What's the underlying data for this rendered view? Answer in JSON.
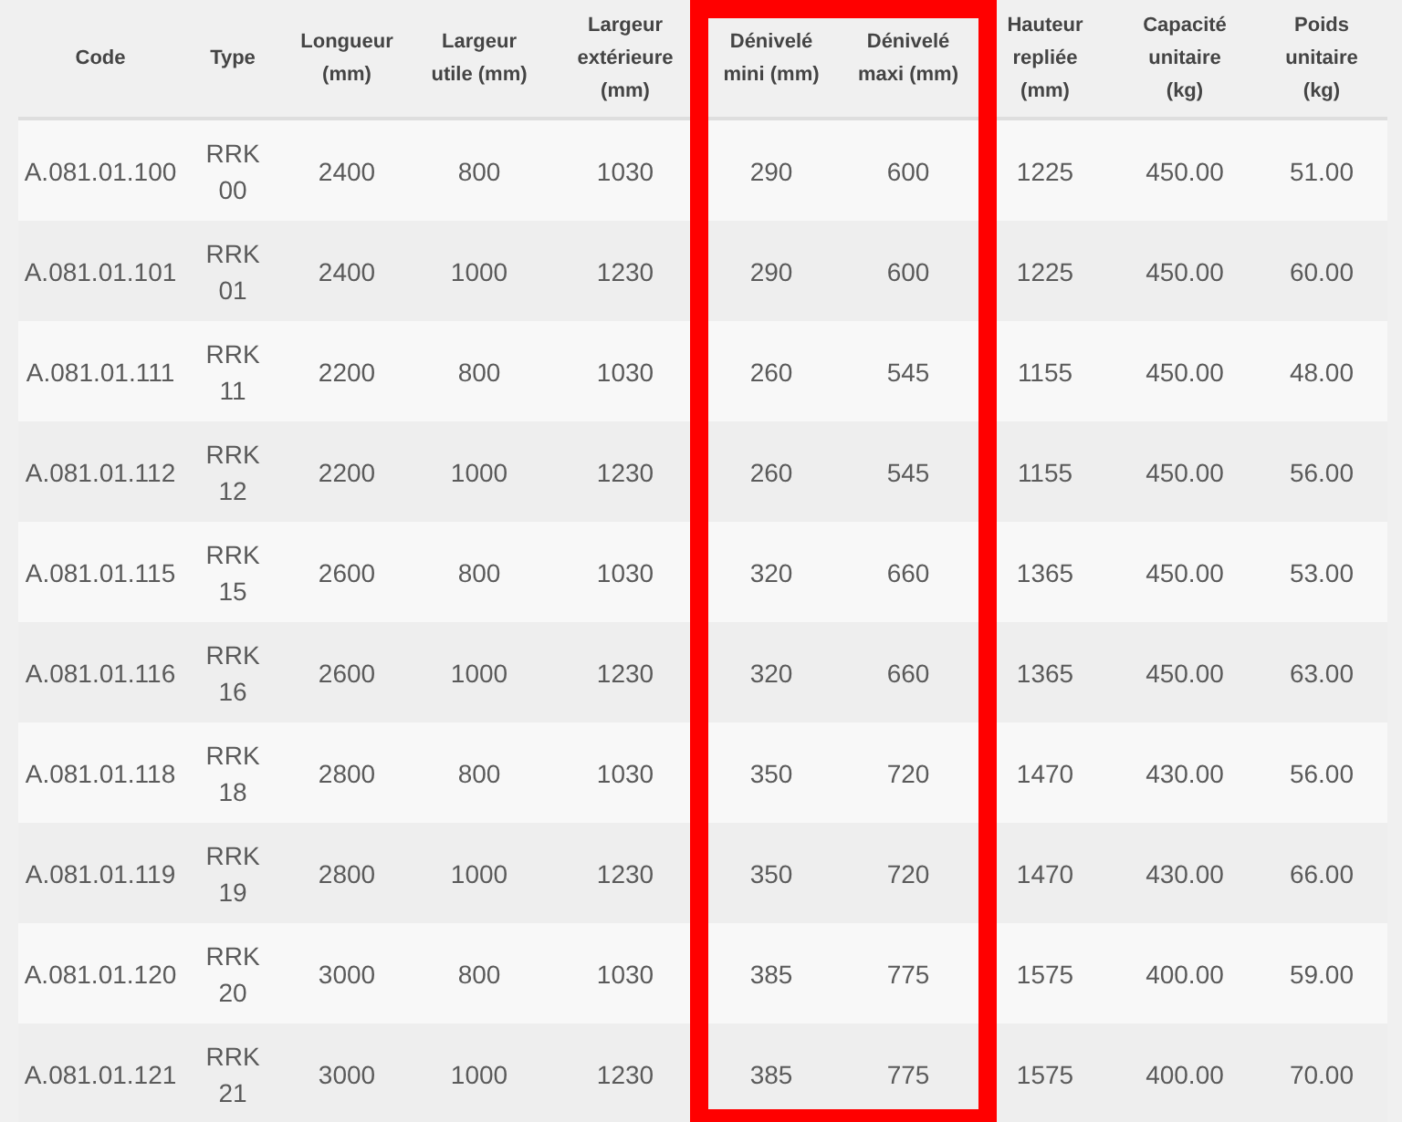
{
  "table": {
    "columns": [
      {
        "label": "Code",
        "highlighted": false
      },
      {
        "label": "Type",
        "highlighted": false
      },
      {
        "label": "Longueur (mm)",
        "highlighted": false
      },
      {
        "label": "Largeur utile (mm)",
        "highlighted": false
      },
      {
        "label": "Largeur extérieure (mm)",
        "highlighted": false
      },
      {
        "label": "Dénivelé mini (mm)",
        "highlighted": true
      },
      {
        "label": "Dénivelé maxi (mm)",
        "highlighted": true
      },
      {
        "label": "Hauteur repliée (mm)",
        "highlighted": false
      },
      {
        "label": "Capacité unitaire (kg)",
        "highlighted": false
      },
      {
        "label": "Poids unitaire (kg)",
        "highlighted": false
      }
    ],
    "rows": [
      [
        "A.081.01.100",
        "RRK 00",
        "2400",
        "800",
        "1030",
        "290",
        "600",
        "1225",
        "450.00",
        "51.00"
      ],
      [
        "A.081.01.101",
        "RRK 01",
        "2400",
        "1000",
        "1230",
        "290",
        "600",
        "1225",
        "450.00",
        "60.00"
      ],
      [
        "A.081.01.111",
        "RRK 11",
        "2200",
        "800",
        "1030",
        "260",
        "545",
        "1155",
        "450.00",
        "48.00"
      ],
      [
        "A.081.01.112",
        "RRK 12",
        "2200",
        "1000",
        "1230",
        "260",
        "545",
        "1155",
        "450.00",
        "56.00"
      ],
      [
        "A.081.01.115",
        "RRK 15",
        "2600",
        "800",
        "1030",
        "320",
        "660",
        "1365",
        "450.00",
        "53.00"
      ],
      [
        "A.081.01.116",
        "RRK 16",
        "2600",
        "1000",
        "1230",
        "320",
        "660",
        "1365",
        "450.00",
        "63.00"
      ],
      [
        "A.081.01.118",
        "RRK 18",
        "2800",
        "800",
        "1030",
        "350",
        "720",
        "1470",
        "430.00",
        "56.00"
      ],
      [
        "A.081.01.119",
        "RRK 19",
        "2800",
        "1000",
        "1230",
        "350",
        "720",
        "1470",
        "430.00",
        "66.00"
      ],
      [
        "A.081.01.120",
        "RRK 20",
        "3000",
        "800",
        "1030",
        "385",
        "775",
        "1575",
        "400.00",
        "59.00"
      ],
      [
        "A.081.01.121",
        "RRK 21",
        "3000",
        "1000",
        "1230",
        "385",
        "775",
        "1575",
        "400.00",
        "70.00"
      ]
    ]
  }
}
